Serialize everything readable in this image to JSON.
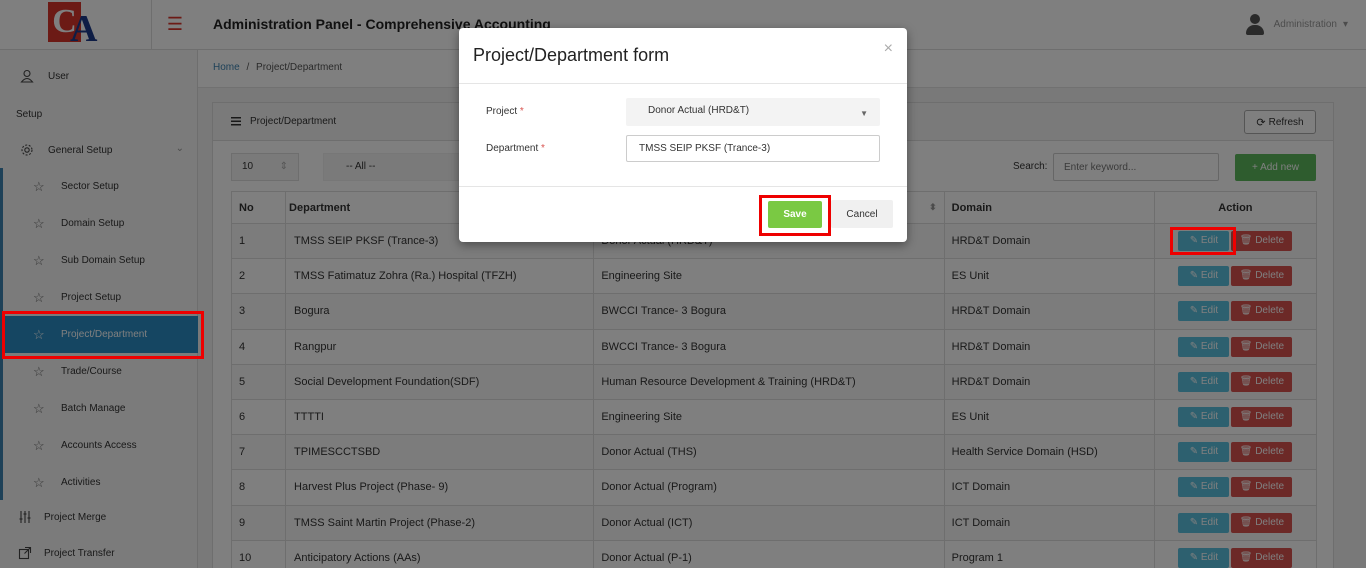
{
  "header": {
    "title": "Administration Panel - Comprehensive Accounting",
    "user": "Administration",
    "caret": "▾"
  },
  "logo": {
    "c": "C",
    "a": "A"
  },
  "sidebar": {
    "hamburger": "☰",
    "user_label": "User",
    "section": "Setup",
    "general_setup": "General Setup",
    "chevron": "⌄",
    "sub_items": [
      {
        "label": "Sector Setup"
      },
      {
        "label": "Domain Setup"
      },
      {
        "label": "Sub Domain Setup"
      },
      {
        "label": "Project Setup"
      },
      {
        "label": "Project/Department",
        "active": true
      },
      {
        "label": "Trade/Course"
      },
      {
        "label": "Batch Manage"
      },
      {
        "label": "Accounts Access"
      },
      {
        "label": "Activities"
      }
    ],
    "project_merge": "Project Merge",
    "project_transfer": "Project Transfer"
  },
  "breadcrumb": {
    "home": "Home",
    "separator": "/",
    "current": "Project/Department"
  },
  "panel": {
    "title": "Project/Department",
    "refresh": "Refresh",
    "page_length": "10",
    "filter_all": "-- All --",
    "search_label": "Search:",
    "search_placeholder": "Enter keyword...",
    "add_new": "+ Add new"
  },
  "table": {
    "headers": {
      "no": "No",
      "department": "Department",
      "project": "",
      "domain": "Domain",
      "action": "Action"
    },
    "edit_label": "Edit",
    "delete_label": "Delete",
    "rows": [
      {
        "no": "1",
        "department": "TMSS SEIP PKSF (Trance-3)",
        "project": "Donor Actual (HRD&T)",
        "domain": "HRD&T Domain"
      },
      {
        "no": "2",
        "department": "TMSS Fatimatuz Zohra (Ra.) Hospital (TFZH)",
        "project": "Engineering Site",
        "domain": "ES Unit"
      },
      {
        "no": "3",
        "department": "Bogura",
        "project": "BWCCI Trance- 3 Bogura",
        "domain": "HRD&T Domain"
      },
      {
        "no": "4",
        "department": "Rangpur",
        "project": "BWCCI Trance- 3 Bogura",
        "domain": "HRD&T Domain"
      },
      {
        "no": "5",
        "department": "Social Development Foundation(SDF)",
        "project": "Human Resource Development & Training (HRD&T)",
        "domain": "HRD&T Domain"
      },
      {
        "no": "6",
        "department": "TTTTI",
        "project": "Engineering Site",
        "domain": "ES Unit"
      },
      {
        "no": "7",
        "department": "TPIMESCCTSBD",
        "project": "Donor Actual (THS)",
        "domain": "Health Service Domain (HSD)"
      },
      {
        "no": "8",
        "department": "Harvest Plus Project (Phase- 9)",
        "project": "Donor Actual (Program)",
        "domain": "ICT Domain"
      },
      {
        "no": "9",
        "department": "TMSS Saint Martin Project (Phase-2)",
        "project": "Donor Actual (ICT)",
        "domain": "ICT Domain"
      },
      {
        "no": "10",
        "department": "Anticipatory Actions (AAs)",
        "project": "Donor Actual (P-1)",
        "domain": "Program 1"
      }
    ]
  },
  "modal": {
    "title": "Project/Department form",
    "close": "×",
    "project_label": "Project",
    "project_value": "Donor Actual (HRD&T)",
    "department_label": "Department",
    "department_value": "TMSS SEIP PKSF (Trance-3)",
    "required_mark": "*",
    "save": "Save",
    "cancel": "Cancel"
  },
  "colors": {
    "accent": "#2a8cc4",
    "save": "#7ac943",
    "add": "#5cb85c",
    "edit": "#5bc0de",
    "delete": "#d9534f",
    "highlight": "#ee0000"
  }
}
